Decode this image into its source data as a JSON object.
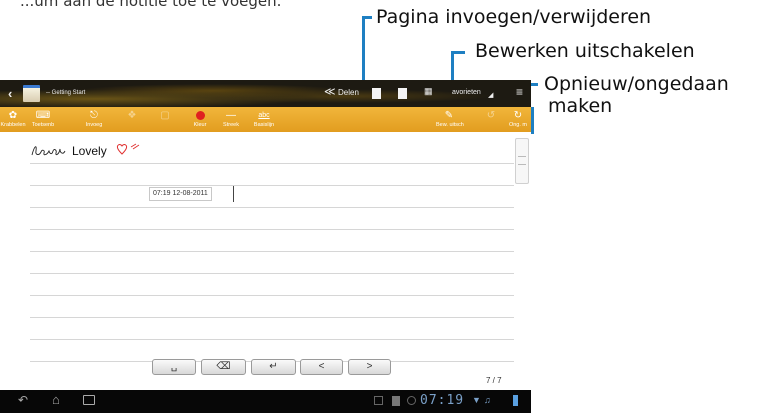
{
  "header_cut_text": "...um aan de notitie toe te voegen.",
  "callouts": {
    "page_insert_delete": "Pagina invoegen/verwijderen",
    "disable_edit": "Bewerken uitschakelen",
    "redo_undo_line1": "Opnieuw/ongedaan",
    "redo_undo_line2": "maken"
  },
  "action_bar": {
    "title": "-- Getting Start",
    "share_label": "Delen",
    "favorites_label": "avorieten"
  },
  "toolbar": {
    "items": [
      {
        "label": "Krabbelen",
        "icon": "scribble-icon"
      },
      {
        "label": "Toetsenb",
        "icon": "keyboard-icon"
      },
      {
        "label": "Invoeg",
        "icon": "insert-icon"
      },
      {
        "label": "",
        "icon": "disabled-icon"
      },
      {
        "label": "",
        "icon": "disabled-icon"
      },
      {
        "label": "Kleur",
        "icon": "color-icon"
      },
      {
        "label": "Streek",
        "icon": "stroke-icon"
      },
      {
        "label": "Basislijn",
        "icon": "baseline-icon",
        "icon_text": "abc"
      },
      {
        "label": "Bew. uitsch",
        "icon": "pen-icon"
      },
      {
        "label": "",
        "icon": "undo-icon"
      },
      {
        "label": "Ong. m",
        "icon": "redo-icon"
      }
    ],
    "accent_color": "#e8a528",
    "color_dot": "#e02020"
  },
  "note": {
    "typed_text": "Lovely",
    "timestamp": "07:19 12-08-2011",
    "page_counter": "7 / 7"
  },
  "status_bar": {
    "time": "07:19"
  },
  "colors": {
    "callout_blue": "#1e7fc2"
  }
}
